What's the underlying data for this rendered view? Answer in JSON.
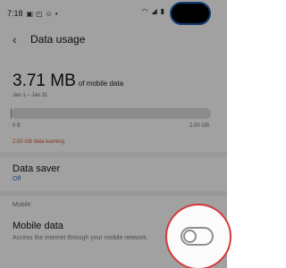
{
  "status_bar": {
    "time": "7:18",
    "left_icons": [
      "image-icon",
      "cast-icon",
      "face-icon",
      "dot-icon"
    ],
    "right_icons": [
      "wifi-icon",
      "signal-icon",
      "battery-icon"
    ]
  },
  "header": {
    "title": "Data usage"
  },
  "usage": {
    "amount": "3.71 MB",
    "suffix": "of mobile data",
    "range": "Jan 1 – Jan 31",
    "progress_fraction": 0.002,
    "min_label": "0 B",
    "max_label": "2.00 GB",
    "warning": "2.00 GB data warning"
  },
  "data_saver": {
    "title": "Data saver",
    "status": "Off"
  },
  "mobile_section": {
    "header": "Mobile",
    "mobile_data": {
      "title": "Mobile data",
      "description": "Access the internet through your mobile network.",
      "enabled": false
    }
  },
  "colors": {
    "warning": "#c8551a",
    "link": "#2f6fb7",
    "highlight_ring": "#d43a3a"
  }
}
